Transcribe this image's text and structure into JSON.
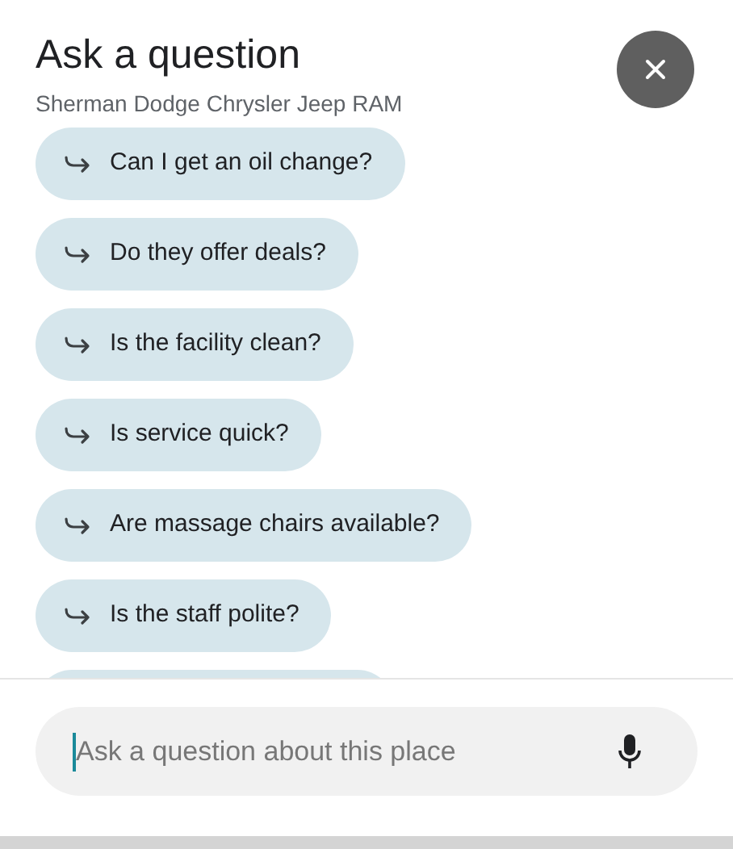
{
  "header": {
    "title": "Ask a question",
    "subtitle": "Sherman Dodge Chrysler Jeep RAM"
  },
  "suggestions": [
    {
      "label": "Can I get an oil change?"
    },
    {
      "label": "Do they offer deals?"
    },
    {
      "label": "Is the facility clean?"
    },
    {
      "label": "Is service quick?"
    },
    {
      "label": "Are massage chairs available?"
    },
    {
      "label": "Is the staff polite?"
    }
  ],
  "question_field": {
    "placeholder": "Ask a question about this place"
  }
}
